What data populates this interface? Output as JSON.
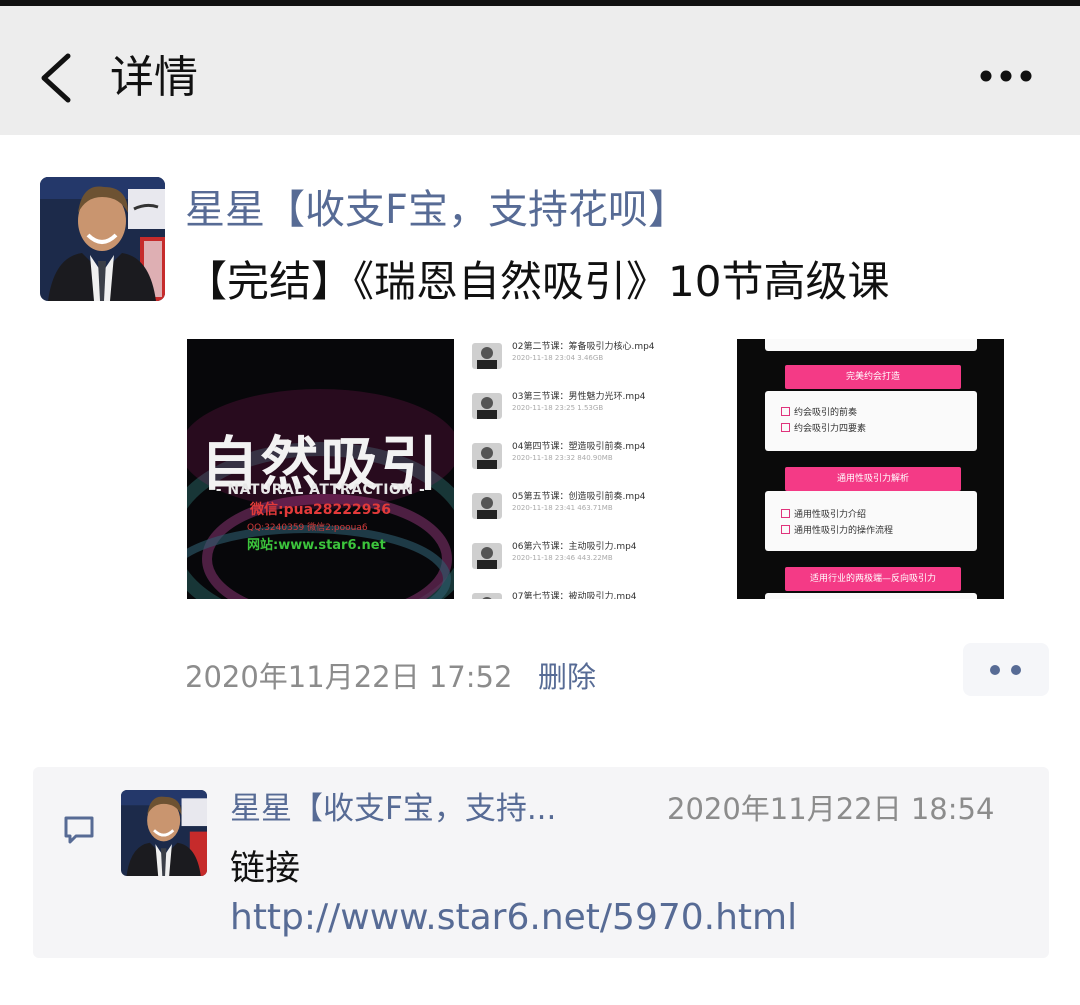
{
  "header": {
    "title": "详情",
    "back_icon": "chevron-left-icon",
    "more_icon": "more-horizontal-icon"
  },
  "post": {
    "author": "星星【收支F宝，支持花呗】",
    "text": "【完结】《瑞恩自然吸引》10节高级课",
    "timestamp": "2020年11月22日 17:52",
    "delete_label": "删除",
    "images": [
      {
        "title": "自然吸引",
        "subtitle": "- NATURAL ATTRACTION -",
        "wechat": "微信:pua28222936",
        "qq": "QQ:3240359 微信2:pooua6",
        "site": "网站:www.star6.net"
      },
      {
        "files": [
          {
            "name": "02第二节课：筹备吸引力核心.mp4",
            "meta": "2020-11-18 23:04 3.46GB"
          },
          {
            "name": "03第三节课：男性魅力光环.mp4",
            "meta": "2020-11-18 23:25 1.53GB"
          },
          {
            "name": "04第四节课：塑造吸引前奏.mp4",
            "meta": "2020-11-18 23:32 840.90MB"
          },
          {
            "name": "05第五节课：创造吸引前奏.mp4",
            "meta": "2020-11-18 23:41 463.71MB"
          },
          {
            "name": "06第六节课：主动吸引力.mp4",
            "meta": "2020-11-18 23:46 443.22MB"
          },
          {
            "name": "07第七节课：被动吸引力.mp4",
            "meta": ""
          }
        ]
      },
      {
        "sections": [
          {
            "heading": "完美约会打造",
            "items": [
              "约会吸引的前奏",
              "约会吸引力四要素"
            ]
          },
          {
            "heading": "通用性吸引力解析",
            "items": [
              "通用性吸引力介绍",
              "通用性吸引力的操作流程"
            ]
          },
          {
            "heading": "适用行业的两极端—反向吸引力",
            "items": []
          }
        ]
      }
    ]
  },
  "comment": {
    "icon": "comment-icon",
    "author": "星星【收支F宝，支持...",
    "timestamp": "2020年11月22日 18:54",
    "text": "链接",
    "link": "http://www.star6.net/5970.html"
  },
  "colors": {
    "link_blue": "#576b95",
    "header_bg": "#ededed",
    "accent_pink": "#f43a86"
  }
}
